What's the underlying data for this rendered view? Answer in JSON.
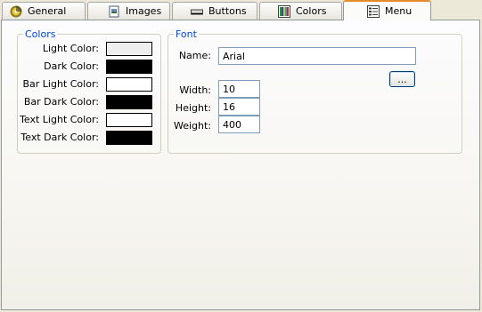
{
  "tabs": [
    {
      "label": "General",
      "icon": "disc-icon",
      "active": false
    },
    {
      "label": "Images",
      "icon": "image-file-icon",
      "active": false
    },
    {
      "label": "Buttons",
      "icon": "button-icon",
      "active": false
    },
    {
      "label": "Colors",
      "icon": "color-bars-icon",
      "active": false
    },
    {
      "label": "Menu",
      "icon": "menu-icon",
      "active": true
    }
  ],
  "colors_group": {
    "title": "Colors",
    "items": [
      {
        "label": "Light Color:",
        "color": "#eeeeee"
      },
      {
        "label": "Dark Color:",
        "color": "#000000"
      },
      {
        "label": "Bar Light Color:",
        "color": "#ffffff"
      },
      {
        "label": "Bar Dark Color:",
        "color": "#000000"
      },
      {
        "label": "Text Light Color:",
        "color": "#ffffff"
      },
      {
        "label": "Text Dark Color:",
        "color": "#000000"
      }
    ]
  },
  "font_group": {
    "title": "Font",
    "name_label": "Name:",
    "name_value": "Arial",
    "browse_label": "...",
    "width_label": "Width:",
    "width_value": "10",
    "height_label": "Height:",
    "height_value": "16",
    "weight_label": "Weight:",
    "weight_value": "400"
  }
}
